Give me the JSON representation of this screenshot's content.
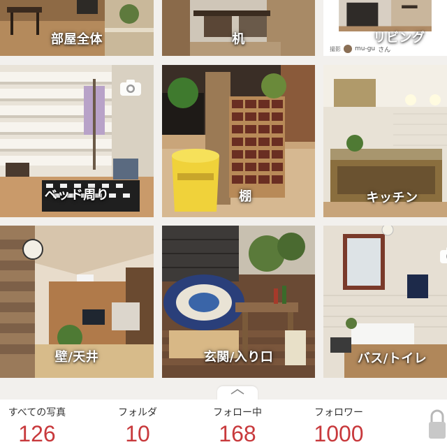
{
  "rooms": [
    {
      "label": "部屋全体"
    },
    {
      "label": "机"
    },
    {
      "label": "リビング"
    },
    {
      "label": "ベッド周り"
    },
    {
      "label": "棚"
    },
    {
      "label": "キッチン"
    },
    {
      "label": "壁/天井"
    },
    {
      "label": "玄関/入り口"
    },
    {
      "label": "バス/トイレ"
    }
  ],
  "tile_owner": {
    "badge": "撮影",
    "name": "mu-gu",
    "suffix": "さん"
  },
  "stats": [
    {
      "label": "すべての写真",
      "value": "126"
    },
    {
      "label": "フォルダ",
      "value": "10"
    },
    {
      "label": "フォロー中",
      "value": "168"
    },
    {
      "label": "フォロワー",
      "value": "1000"
    }
  ],
  "colors": {
    "stat_value": "#c8393c",
    "background": "#f2f0ed"
  },
  "icons": [
    "camera-icon",
    "chevron-up-icon",
    "lock-icon"
  ]
}
